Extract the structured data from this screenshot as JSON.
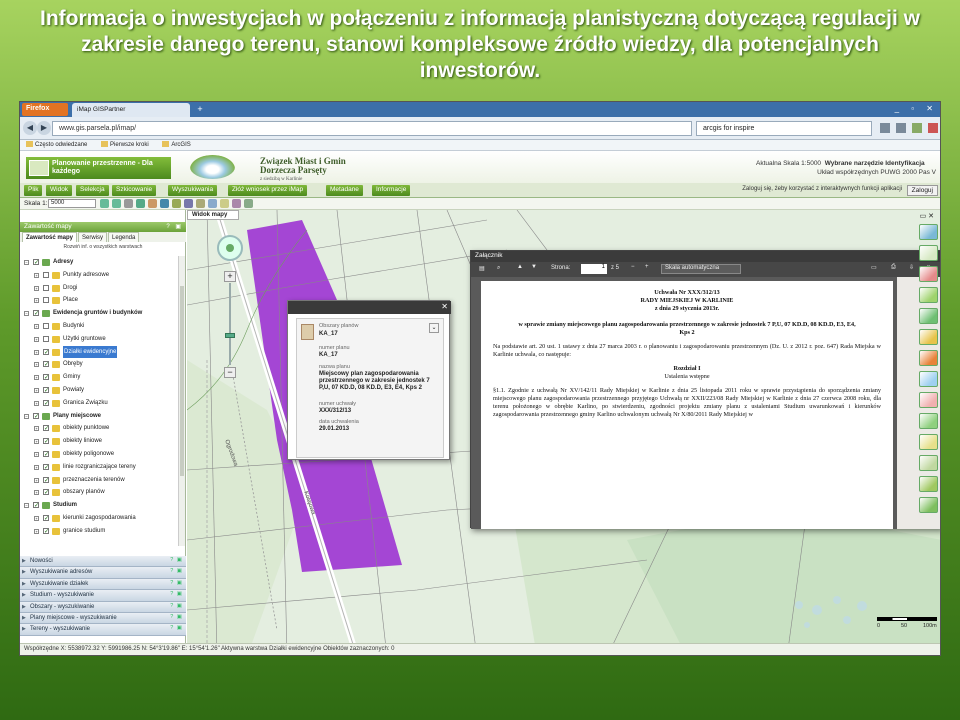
{
  "slide": {
    "title": "Informacja o inwestycjach w połączeniu z informacją planistyczną dotyczącą regulacji w zakresie danego terenu, stanowi kompleksowe źródło wiedzy, dla potencjalnych inwestorów."
  },
  "browser": {
    "menu_button": "Firefox",
    "tab_title": "iMap GISPartner",
    "url": "www.gis.parsela.pl/imap/",
    "search_value": "arcgis for inspire",
    "bookmarks": [
      "Często odwiedzane",
      "Pierwsze kroki",
      "ArcGIS"
    ]
  },
  "header": {
    "plan_button": "Planowanie przestrzenne - Dla każdego",
    "org_line1": "Związek Miast i Gmin",
    "org_line2": "Dorzecza Parsęty",
    "org_sub": "z siedzibą w Karlinie",
    "scale_label": "Aktualna Skala 1:5000",
    "tool_label": "Wybrane narzędzie Identyfikacja",
    "crs_label": "Układ współrzędnych PUWG 2000 Pas V"
  },
  "menu": {
    "items": [
      "Plik",
      "Widok",
      "Selekcja",
      "Szkicowanie",
      "Wyszukiwania",
      "Złóż wniosek przez iMap",
      "Metadane",
      "Informacje"
    ],
    "login_info": "Zaloguj się, żeby korzystać z interaktywnych funkcji aplikacji",
    "login_button": "Zaloguj"
  },
  "toolbar": {
    "scale_label": "Skala 1:",
    "scale_value": "5000"
  },
  "sidebar": {
    "title": "Zawartość mapy",
    "tabs": [
      "Zawartość mapy",
      "Serwisy",
      "Legenda"
    ],
    "expand_info": "Rozwiń inf. o wszystkich warstwach",
    "tree": [
      {
        "label": "Adresy",
        "level": 0,
        "group": true,
        "checked": true
      },
      {
        "label": "Punkty adresowe",
        "level": 1,
        "checked": false
      },
      {
        "label": "Drogi",
        "level": 1,
        "checked": false
      },
      {
        "label": "Place",
        "level": 1,
        "checked": false
      },
      {
        "label": "Ewidencja gruntów i budynków",
        "level": 0,
        "group": true,
        "checked": true
      },
      {
        "label": "Budynki",
        "level": 1,
        "checked": false
      },
      {
        "label": "Użytki gruntowe",
        "level": 1,
        "checked": false
      },
      {
        "label": "Działki ewidencyjne",
        "level": 1,
        "checked": true,
        "highlight": true
      },
      {
        "label": "Obręby",
        "level": 1,
        "checked": true
      },
      {
        "label": "Gminy",
        "level": 1,
        "checked": true
      },
      {
        "label": "Powiaty",
        "level": 1,
        "checked": true
      },
      {
        "label": "Granica Związku",
        "level": 1,
        "checked": true
      },
      {
        "label": "Plany miejscowe",
        "level": 0,
        "group": true,
        "checked": true
      },
      {
        "label": "obiekty punktowe",
        "level": 1,
        "checked": true
      },
      {
        "label": "obiekty liniowe",
        "level": 1,
        "checked": true
      },
      {
        "label": "obiekty poligonowe",
        "level": 1,
        "checked": true
      },
      {
        "label": "linie rozgraniczające tereny",
        "level": 1,
        "checked": true
      },
      {
        "label": "przeznaczenia terenów",
        "level": 1,
        "checked": true
      },
      {
        "label": "obszary planów",
        "level": 1,
        "checked": true
      },
      {
        "label": "Studium",
        "level": 0,
        "group": true,
        "checked": true
      },
      {
        "label": "kierunki zagospodarowania",
        "level": 1,
        "checked": true
      },
      {
        "label": "granice studium",
        "level": 1,
        "checked": true
      }
    ],
    "panels": [
      "Nowości",
      "Wyszukiwanie adresów",
      "Wyszukiwanie działek",
      "Studium - wyszukiwanie",
      "Obszary - wyszukiwanie",
      "Plany miejscowe - wyszukiwanie",
      "Tereny - wyszukiwanie"
    ]
  },
  "map": {
    "tab": "Widok mapy",
    "road_label": "Kolejowa",
    "street_label": "Ogrodowa"
  },
  "popup": {
    "header_label": "Obszary planów",
    "header_value": "KA_17",
    "fields": [
      {
        "label": "numer planu",
        "value": "KA_17"
      },
      {
        "label": "nazwa planu",
        "value": "Miejscowy plan zagospodarowania przestrzennego w zakresie jednostek 7 P,U, 07 KD.D, 08 KD.D, E3, E4, Kps 2"
      },
      {
        "label": "numer uchwały",
        "value": "XXX/312/13"
      },
      {
        "label": "data uchwalenia",
        "value": "29.01.2013"
      }
    ]
  },
  "pdf": {
    "window_title": "Załącznik",
    "page_label": "Strona:",
    "page_value": "1",
    "page_total": "z 5",
    "zoom_value": "Skala automatyczna",
    "lines": {
      "h1": "Uchwała Nr XXX/312/13",
      "h2": "RADY MIEJSKIEJ W KARLINIE",
      "h3": "z dnia 29 stycznia 2013r.",
      "subject": "w sprawie zmiany miejscowego planu zagospodarowania przestrzennego w zakresie jednostek 7 P,U, 07 KD.D, 08 KD.D, E3, E4, Kps 2",
      "para1": "Na podstawie art. 20 ust. 1 ustawy z dnia 27 marca 2003 r. o planowaniu i zagospodarowaniu przestrzennym (Dz. U. z 2012 r. poz. 647) Rada Miejska w Karlinie uchwala, co następuje:",
      "chapter": "Rozdział I",
      "chapter_title": "Ustalenia wstępne",
      "para2": "§1.1. Zgodnie z uchwałą Nr XV/142/11 Rady Miejskiej w Karlinie z dnia 25 listopada 2011 roku w sprawie przystąpienia do sporządzenia zmiany miejscowego planu zagospodarowania przestrzennego przyjętego Uchwałą nr XXII/223/08 Rady Miejskiej w Karlinie z dnia 27 czerwca 2008 roku, dla terenu położonego w obrębie Karlino, po stwierdzeniu, zgodności projektu zmiany planu z ustaleniami Studium uwarunkowań i kierunków zagospodarowania przestrzennego gminy Karlino uchwalonym uchwałą Nr X/80/2011 Rady Miejskiej w"
    }
  },
  "statusbar": {
    "text": "Współrzędne X: 5538972.32 Y: 5991986.25   N: 54°3'19.86\" E: 15°54'1.26\"   Aktywna warstwa Działki ewidencyjne   Obiektów zaznaczonych: 0"
  },
  "scalebar": {
    "labels": [
      "0",
      "50",
      "100m"
    ]
  }
}
